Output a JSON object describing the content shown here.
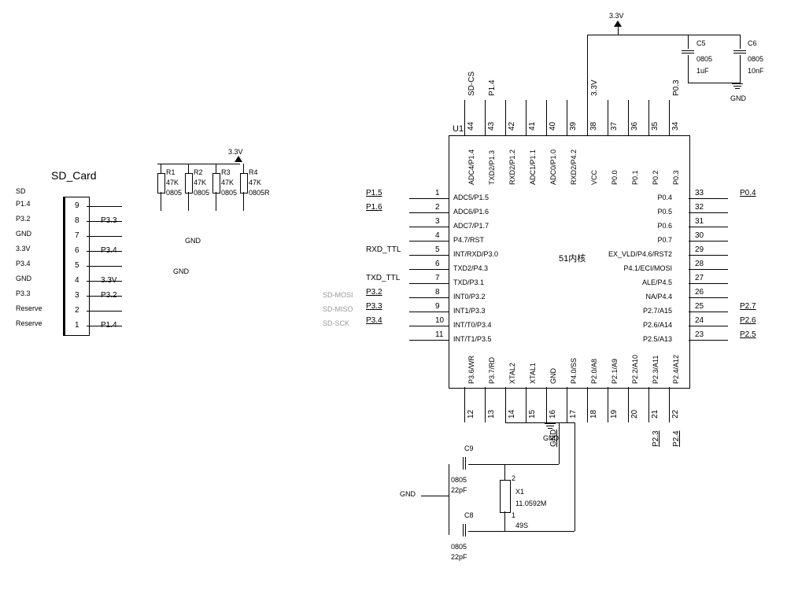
{
  "chart_data": {
    "type": "schematic",
    "title": "SD Card + MCU (51-core) schematic",
    "blocks": {
      "sd_card": {
        "name": "SD_Card",
        "ref": "SD",
        "pins": [
          {
            "n": 9,
            "net": "P1.4"
          },
          {
            "n": 8,
            "net": "P3.3"
          },
          {
            "n": 7,
            "net": ""
          },
          {
            "n": 6,
            "net": "P3.4"
          },
          {
            "n": 5,
            "net": ""
          },
          {
            "n": 4,
            "net": "3.3V"
          },
          {
            "n": 3,
            "net": "P3.2"
          },
          {
            "n": 2,
            "net": ""
          },
          {
            "n": 1,
            "net": "P1.4"
          }
        ],
        "left_labels": [
          "P1.4",
          "P3.2",
          "GND",
          "3.3V",
          "P3.4",
          "GND",
          "P3.3",
          "Reserve",
          "Reserve"
        ]
      },
      "mcu": {
        "ref": "U1",
        "core": "51内核",
        "left_pins": [
          {
            "n": 1,
            "name": "ADC5/P1.5",
            "net": "P1.5"
          },
          {
            "n": 2,
            "name": "ADC6/P1.6",
            "net": "P1.6"
          },
          {
            "n": 3,
            "name": "ADC7/P1.7",
            "net": ""
          },
          {
            "n": 4,
            "name": "P4.7/RST",
            "net": ""
          },
          {
            "n": 5,
            "name": "INT/RXD/P3.0",
            "net": "RXD_TTL"
          },
          {
            "n": 6,
            "name": "TXD2/P4.3",
            "net": ""
          },
          {
            "n": 7,
            "name": "TXD/P3.1",
            "net": "TXD_TTL"
          },
          {
            "n": 8,
            "name": "INT0/P3.2",
            "net": "P3.2",
            "note": "SD-MOSI"
          },
          {
            "n": 9,
            "name": "INT1/P3.3",
            "net": "P3.3",
            "note": "SD-MISO"
          },
          {
            "n": 10,
            "name": "INT/T0/P3.4",
            "net": "P3.4",
            "note": "SD-SCK"
          },
          {
            "n": 11,
            "name": "INT/T1/P3.5",
            "net": ""
          }
        ],
        "top_pins": [
          {
            "n": 44,
            "name": "ADC4/P1.4",
            "net": "SD-CS"
          },
          {
            "n": 43,
            "name": "TXD2/P1.3",
            "net": "P1.4"
          },
          {
            "n": 42,
            "name": "RXD2/P1.2",
            "net": ""
          },
          {
            "n": 41,
            "name": "ADC1/P1.1",
            "net": ""
          },
          {
            "n": 40,
            "name": "ADC0/P1.0",
            "net": ""
          },
          {
            "n": 39,
            "name": "RXD2/P4.2",
            "net": ""
          },
          {
            "n": 38,
            "name": "VCC",
            "net": "3.3V"
          },
          {
            "n": 37,
            "name": "P0.0",
            "net": ""
          },
          {
            "n": 36,
            "name": "P0.1",
            "net": ""
          },
          {
            "n": 35,
            "name": "P0.2",
            "net": ""
          },
          {
            "n": 34,
            "name": "P0.3",
            "net": "P0.3"
          }
        ],
        "right_pins": [
          {
            "n": 33,
            "name": "P0.4",
            "net": "P0.4"
          },
          {
            "n": 32,
            "name": "P0.5",
            "net": ""
          },
          {
            "n": 31,
            "name": "P0.6",
            "net": ""
          },
          {
            "n": 30,
            "name": "P0.7",
            "net": ""
          },
          {
            "n": 29,
            "name": "EX_VLD/P4.6/RST2",
            "net": ""
          },
          {
            "n": 28,
            "name": "P4.1/ECI/MOSI",
            "net": ""
          },
          {
            "n": 27,
            "name": "ALE/P4.5",
            "net": ""
          },
          {
            "n": 26,
            "name": "NA/P4.4",
            "net": ""
          },
          {
            "n": 25,
            "name": "P2.7/A15",
            "net": "P2.7"
          },
          {
            "n": 24,
            "name": "P2.6/A14",
            "net": "P2.6"
          },
          {
            "n": 23,
            "name": "P2.5/A13",
            "net": "P2.5"
          }
        ],
        "bottom_pins": [
          {
            "n": 12,
            "name": "P3.6/WR",
            "net": ""
          },
          {
            "n": 13,
            "name": "P3.7/RD",
            "net": ""
          },
          {
            "n": 14,
            "name": "XTAL2",
            "net": ""
          },
          {
            "n": 15,
            "name": "XTAL1",
            "net": ""
          },
          {
            "n": 16,
            "name": "GND",
            "net": "GND"
          },
          {
            "n": 17,
            "name": "P4.0/SS",
            "net": ""
          },
          {
            "n": 18,
            "name": "P2.0/A8",
            "net": ""
          },
          {
            "n": 19,
            "name": "P2.1/A9",
            "net": ""
          },
          {
            "n": 20,
            "name": "P2.2/A10",
            "net": ""
          },
          {
            "n": 21,
            "name": "P2.3/A11",
            "net": "P2.3"
          },
          {
            "n": 22,
            "name": "P2.4/A12",
            "net": "P2.4"
          }
        ]
      }
    },
    "components": {
      "resistors": [
        {
          "ref": "R1",
          "value": "47K",
          "package": "0805"
        },
        {
          "ref": "R2",
          "value": "47K",
          "package": "0805"
        },
        {
          "ref": "R3",
          "value": "47K",
          "package": "0805"
        },
        {
          "ref": "R4",
          "value": "47K",
          "package": "0805R"
        }
      ],
      "capacitors": [
        {
          "ref": "C5",
          "value": "1uF",
          "package": "0805"
        },
        {
          "ref": "C6",
          "value": "10nF",
          "package": "0805"
        },
        {
          "ref": "C8",
          "value": "22pF",
          "package": "0805"
        },
        {
          "ref": "C9",
          "value": "22pF",
          "package": "0805"
        }
      ],
      "crystal": {
        "ref": "X1",
        "freq": "11.0592M",
        "package": "49S",
        "pins": [
          "1",
          "2"
        ]
      }
    },
    "power_rails": [
      "3.3V",
      "GND"
    ]
  },
  "sd": {
    "title": "SD_Card",
    "ref": "SD",
    "ll": [
      "P1.4",
      "P3.2",
      "GND",
      "3.3V",
      "P3.4",
      "GND",
      "P3.3",
      "Reserve",
      "Reserve"
    ],
    "pins": [
      "9",
      "8",
      "7",
      "6",
      "5",
      "4",
      "3",
      "2",
      "1"
    ],
    "nets": [
      "",
      "P3.3",
      "",
      "P3.4",
      "",
      "3.3V",
      "P3.2",
      "",
      "P1.4"
    ]
  },
  "pull": {
    "r1": {
      "ref": "R1",
      "v": "47K",
      "p": "0805"
    },
    "r2": {
      "ref": "R2",
      "v": "47K",
      "p": "0805"
    },
    "r3": {
      "ref": "R3",
      "v": "47K",
      "p": "0805"
    },
    "r4": {
      "ref": "R4",
      "v": "47K",
      "p": "0805R"
    },
    "rail": "3.3V",
    "gnd1": "GND",
    "gnd2": "GND"
  },
  "u1": {
    "ref": "U1",
    "core": "51内核",
    "left": [
      {
        "n": "1",
        "name": "ADC5/P1.5",
        "net": "P1.5"
      },
      {
        "n": "2",
        "name": "ADC6/P1.6",
        "net": "P1.6"
      },
      {
        "n": "3",
        "name": "ADC7/P1.7",
        "net": ""
      },
      {
        "n": "4",
        "name": "P4.7/RST",
        "net": ""
      },
      {
        "n": "5",
        "name": "INT/RXD/P3.0",
        "net": "RXD_TTL"
      },
      {
        "n": "6",
        "name": "TXD2/P4.3",
        "net": ""
      },
      {
        "n": "7",
        "name": "TXD/P3.1",
        "net": "TXD_TTL"
      },
      {
        "n": "8",
        "name": "INT0/P3.2",
        "net": "P3.2",
        "note": "SD-MOSI"
      },
      {
        "n": "9",
        "name": "INT1/P3.3",
        "net": "P3.3",
        "note": "SD-MISO"
      },
      {
        "n": "10",
        "name": "INT/T0/P3.4",
        "net": "P3.4",
        "note": "SD-SCK"
      },
      {
        "n": "11",
        "name": "INT/T1/P3.5",
        "net": ""
      }
    ],
    "top": [
      {
        "n": "44",
        "name": "ADC4/P1.4",
        "net": "SD-CS"
      },
      {
        "n": "43",
        "name": "TXD2/P1.3",
        "net": "P1.4"
      },
      {
        "n": "42",
        "name": "RXD2/P1.2"
      },
      {
        "n": "41",
        "name": "ADC1/P1.1"
      },
      {
        "n": "40",
        "name": "ADC0/P1.0"
      },
      {
        "n": "39",
        "name": "RXD2/P4.2"
      },
      {
        "n": "38",
        "name": "VCC",
        "net": "3.3V"
      },
      {
        "n": "37",
        "name": "P0.0"
      },
      {
        "n": "36",
        "name": "P0.1"
      },
      {
        "n": "35",
        "name": "P0.2"
      },
      {
        "n": "34",
        "name": "P0.3",
        "net": "P0.3"
      }
    ],
    "right": [
      {
        "n": "33",
        "name": "P0.4",
        "net": "P0.4"
      },
      {
        "n": "32",
        "name": "P0.5"
      },
      {
        "n": "31",
        "name": "P0.6"
      },
      {
        "n": "30",
        "name": "P0.7"
      },
      {
        "n": "29",
        "name": "EX_VLD/P4.6/RST2"
      },
      {
        "n": "28",
        "name": "P4.1/ECI/MOSI"
      },
      {
        "n": "27",
        "name": "ALE/P4.5"
      },
      {
        "n": "26",
        "name": "NA/P4.4"
      },
      {
        "n": "25",
        "name": "P2.7/A15",
        "net": "P2.7"
      },
      {
        "n": "24",
        "name": "P2.6/A14",
        "net": "P2.6"
      },
      {
        "n": "23",
        "name": "P2.5/A13",
        "net": "P2.5"
      }
    ],
    "bot": [
      {
        "n": "12",
        "name": "P3.6/WR"
      },
      {
        "n": "13",
        "name": "P3.7/RD"
      },
      {
        "n": "14",
        "name": "XTAL2"
      },
      {
        "n": "15",
        "name": "XTAL1"
      },
      {
        "n": "16",
        "name": "GND",
        "net": "GND"
      },
      {
        "n": "17",
        "name": "P4.0/SS"
      },
      {
        "n": "18",
        "name": "P2.0/A8"
      },
      {
        "n": "19",
        "name": "P2.1/A9"
      },
      {
        "n": "20",
        "name": "P2.2/A10"
      },
      {
        "n": "21",
        "name": "P2.3/A11",
        "net": "P2.3"
      },
      {
        "n": "22",
        "name": "P2.4/A12",
        "net": "P2.4"
      }
    ]
  },
  "decoup": {
    "c5": {
      "ref": "C5",
      "p": "0805",
      "v": "1uF"
    },
    "c6": {
      "ref": "C6",
      "p": "0805",
      "v": "10nF"
    },
    "rail": "3.3V",
    "gnd": "GND"
  },
  "xtal": {
    "c9": {
      "ref": "C9",
      "p": "0805",
      "v": "22pF"
    },
    "c8": {
      "ref": "C8",
      "p": "0805",
      "v": "22pF"
    },
    "x1": {
      "ref": "X1",
      "freq": "11.0592M",
      "pkg": "49S",
      "p1": "1",
      "p2": "2"
    },
    "gnd": "GND"
  }
}
